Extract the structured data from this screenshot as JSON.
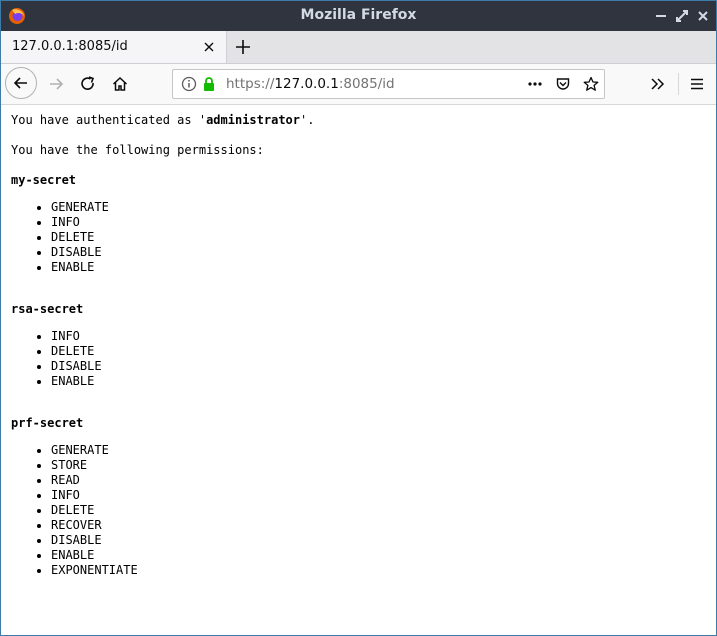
{
  "window": {
    "title": "Mozilla Firefox"
  },
  "tab": {
    "title": "127.0.0.1:8085/id"
  },
  "urlbar": {
    "scheme": "https://",
    "host": "127.0.0.1",
    "rest": ":8085/id"
  },
  "page": {
    "auth_prefix": "You have authenticated as '",
    "auth_user": "administrator",
    "auth_suffix": "'.",
    "permissions_intro": "You have the following permissions:",
    "secrets": [
      {
        "name": "my-secret",
        "permissions": [
          "GENERATE",
          "INFO",
          "DELETE",
          "DISABLE",
          "ENABLE"
        ]
      },
      {
        "name": "rsa-secret",
        "permissions": [
          "INFO",
          "DELETE",
          "DISABLE",
          "ENABLE"
        ]
      },
      {
        "name": "prf-secret",
        "permissions": [
          "GENERATE",
          "STORE",
          "READ",
          "INFO",
          "DELETE",
          "RECOVER",
          "DISABLE",
          "ENABLE",
          "EXPONENTIATE"
        ]
      }
    ]
  },
  "colors": {
    "titlebar": "#2f343f",
    "accent_border": "#3d7ba8",
    "lock": "#12bc00"
  },
  "icons": [
    "firefox-logo-icon",
    "minimize-icon",
    "maximize-icon",
    "close-icon",
    "tab-close-icon",
    "new-tab-icon",
    "back-icon",
    "forward-icon",
    "reload-icon",
    "home-icon",
    "info-icon",
    "lock-icon",
    "page-actions-icon",
    "pocket-icon",
    "bookmark-star-icon",
    "overflow-chevrons-icon",
    "hamburger-menu-icon"
  ]
}
